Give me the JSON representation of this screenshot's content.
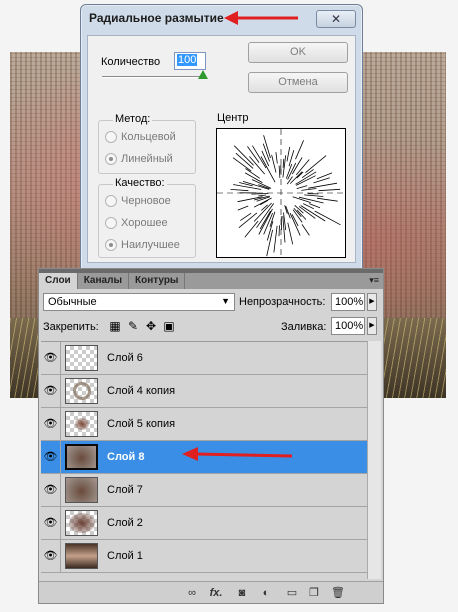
{
  "dialog": {
    "title": "Радиальное размытие",
    "close_glyph": "✕",
    "amount_label": "Количество",
    "amount_value": "100",
    "ok_label": "OK",
    "cancel_label": "Отмена",
    "method_title": "Метод:",
    "method_options": [
      "Кольцевой",
      "Линейный"
    ],
    "method_selected": "Линейный",
    "quality_title": "Качество:",
    "quality_options": [
      "Черновое",
      "Хорошее",
      "Наилучшее"
    ],
    "quality_selected": "Наилучшее",
    "center_label": "Центр"
  },
  "layers_panel": {
    "tabs": [
      "Слои",
      "Каналы",
      "Контуры"
    ],
    "active_tab": "Слои",
    "menu_glyph": "▾≡",
    "blend_mode": "Обычные",
    "opacity_label": "Непрозрачность:",
    "opacity_value": "100%",
    "lock_label": "Закрепить:",
    "fill_label": "Заливка:",
    "fill_value": "100%",
    "layers": [
      {
        "name": "Слой 6",
        "thumb": "transparent",
        "selected": false
      },
      {
        "name": "Слой 4 копия",
        "thumb": "ring",
        "selected": false
      },
      {
        "name": "Слой 5 копия",
        "thumb": "blur-small",
        "selected": false
      },
      {
        "name": "Слой 8",
        "thumb": "photo",
        "selected": true
      },
      {
        "name": "Слой 7",
        "thumb": "photo",
        "selected": false
      },
      {
        "name": "Слой 2",
        "thumb": "blur",
        "selected": false
      },
      {
        "name": "Слой 1",
        "thumb": "gradient",
        "selected": false
      }
    ],
    "bottom_icons": [
      "link-icon",
      "fx-icon",
      "mask-icon",
      "adjustment-icon",
      "folder-icon",
      "new-layer-icon",
      "trash-icon"
    ],
    "fx_glyph": "fx."
  },
  "colors": {
    "selection": "#3a8ee6",
    "annotation_arrow": "#e02020"
  }
}
